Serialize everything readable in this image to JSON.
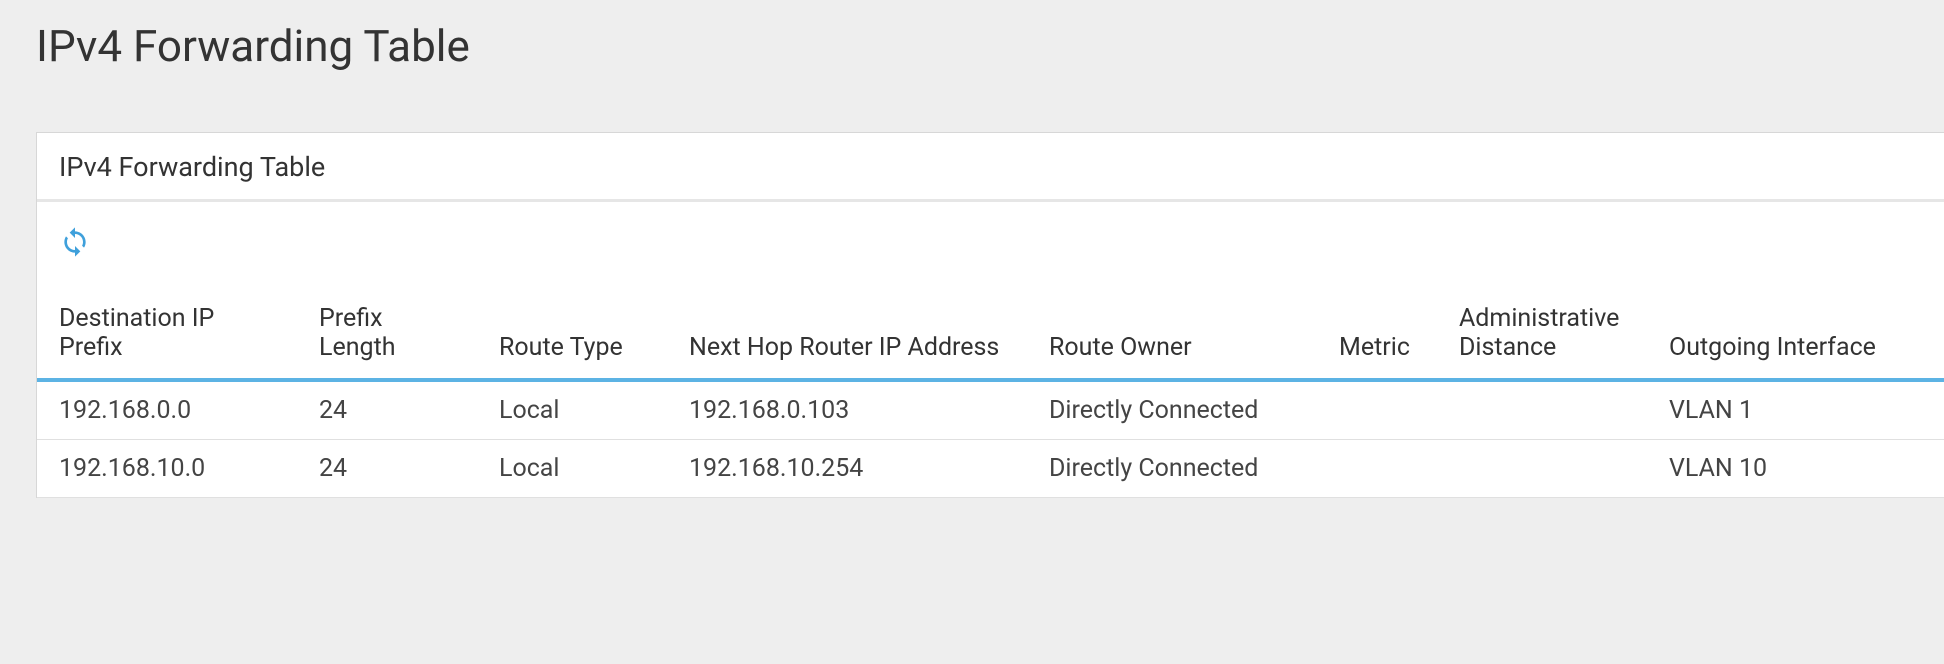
{
  "header": {
    "title": "IPv4 Forwarding Table"
  },
  "panel": {
    "title": "IPv4 Forwarding Table",
    "toolbar": {
      "refresh_label": "Refresh"
    },
    "table": {
      "columns": {
        "dest": "Destination IP Prefix",
        "prefix": "Prefix Length",
        "route_type": "Route Type",
        "next_hop": "Next Hop Router IP Address",
        "owner": "Route Owner",
        "metric": "Metric",
        "admin": "Administrative Distance",
        "out_if": "Outgoing Interface"
      },
      "rows": [
        {
          "dest": "192.168.0.0",
          "prefix": "24",
          "route_type": "Local",
          "next_hop": "192.168.0.103",
          "owner": "Directly Connected",
          "metric": "",
          "admin": "",
          "out_if": "VLAN 1"
        },
        {
          "dest": "192.168.10.0",
          "prefix": "24",
          "route_type": "Local",
          "next_hop": "192.168.10.254",
          "owner": "Directly Connected",
          "metric": "",
          "admin": "",
          "out_if": "VLAN 10"
        }
      ]
    }
  }
}
